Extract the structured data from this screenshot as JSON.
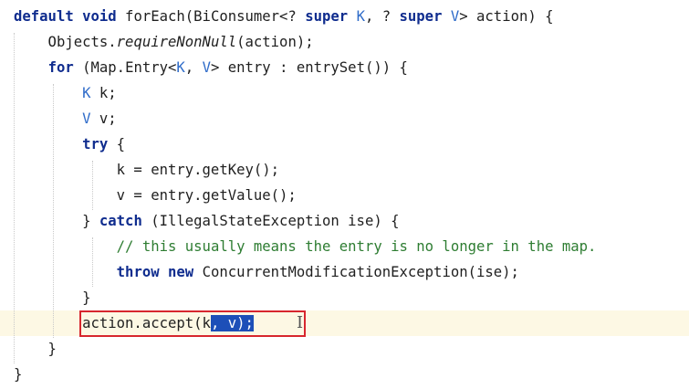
{
  "editor": {
    "lines": [
      {
        "parts": [
          {
            "t": "default",
            "k": "kw"
          },
          {
            "t": " "
          },
          {
            "t": "void",
            "k": "kw"
          },
          {
            "t": " forEach(BiConsumer<? "
          },
          {
            "t": "super",
            "k": "kw"
          },
          {
            "t": " "
          },
          {
            "t": "K",
            "k": "tp"
          },
          {
            "t": ", ? "
          },
          {
            "t": "super",
            "k": "kw"
          },
          {
            "t": " "
          },
          {
            "t": "V",
            "k": "tp"
          },
          {
            "t": "> action) {"
          }
        ]
      },
      {
        "parts": [
          {
            "t": "    Objects."
          },
          {
            "t": "requireNonNull",
            "k": "it"
          },
          {
            "t": "(action);"
          }
        ]
      },
      {
        "parts": [
          {
            "t": "    "
          },
          {
            "t": "for",
            "k": "kw"
          },
          {
            "t": " (Map.Entry<"
          },
          {
            "t": "K",
            "k": "tp"
          },
          {
            "t": ", "
          },
          {
            "t": "V",
            "k": "tp"
          },
          {
            "t": "> entry : entrySet()) {"
          }
        ]
      },
      {
        "parts": [
          {
            "t": "        "
          },
          {
            "t": "K",
            "k": "tp"
          },
          {
            "t": " k;"
          }
        ]
      },
      {
        "parts": [
          {
            "t": "        "
          },
          {
            "t": "V",
            "k": "tp"
          },
          {
            "t": " v;"
          }
        ]
      },
      {
        "parts": [
          {
            "t": "        "
          },
          {
            "t": "try",
            "k": "kw"
          },
          {
            "t": " {"
          }
        ]
      },
      {
        "parts": [
          {
            "t": "            k = entry.getKey();"
          }
        ]
      },
      {
        "parts": [
          {
            "t": "            v = entry.getValue();"
          }
        ]
      },
      {
        "parts": [
          {
            "t": "        } "
          },
          {
            "t": "catch",
            "k": "kw"
          },
          {
            "t": " (IllegalStateException ise) {"
          }
        ]
      },
      {
        "parts": [
          {
            "t": "            "
          },
          {
            "t": "// this usually means the entry is no longer in the map.",
            "k": "cm"
          }
        ]
      },
      {
        "parts": [
          {
            "t": "            "
          },
          {
            "t": "throw",
            "k": "kw"
          },
          {
            "t": " "
          },
          {
            "t": "new",
            "k": "kw"
          },
          {
            "t": " ConcurrentModificationException(ise);"
          }
        ]
      },
      {
        "parts": [
          {
            "t": "        }"
          }
        ]
      },
      {
        "current": true,
        "parts": [
          {
            "t": "        action.accept(k"
          },
          {
            "t": ", v);",
            "k": "sel"
          }
        ]
      },
      {
        "parts": [
          {
            "t": "    }"
          }
        ]
      },
      {
        "parts": [
          {
            "t": "}"
          }
        ]
      }
    ]
  },
  "colors": {
    "keyword": "#0f2c8e",
    "type_param": "#2e6bc9",
    "comment": "#2e7d32",
    "selection": "#1d4fb8",
    "current_line": "#fdf8e4",
    "highlight_box": "#d7262e"
  },
  "icons": {
    "cursor": "i-beam-cursor-icon"
  }
}
